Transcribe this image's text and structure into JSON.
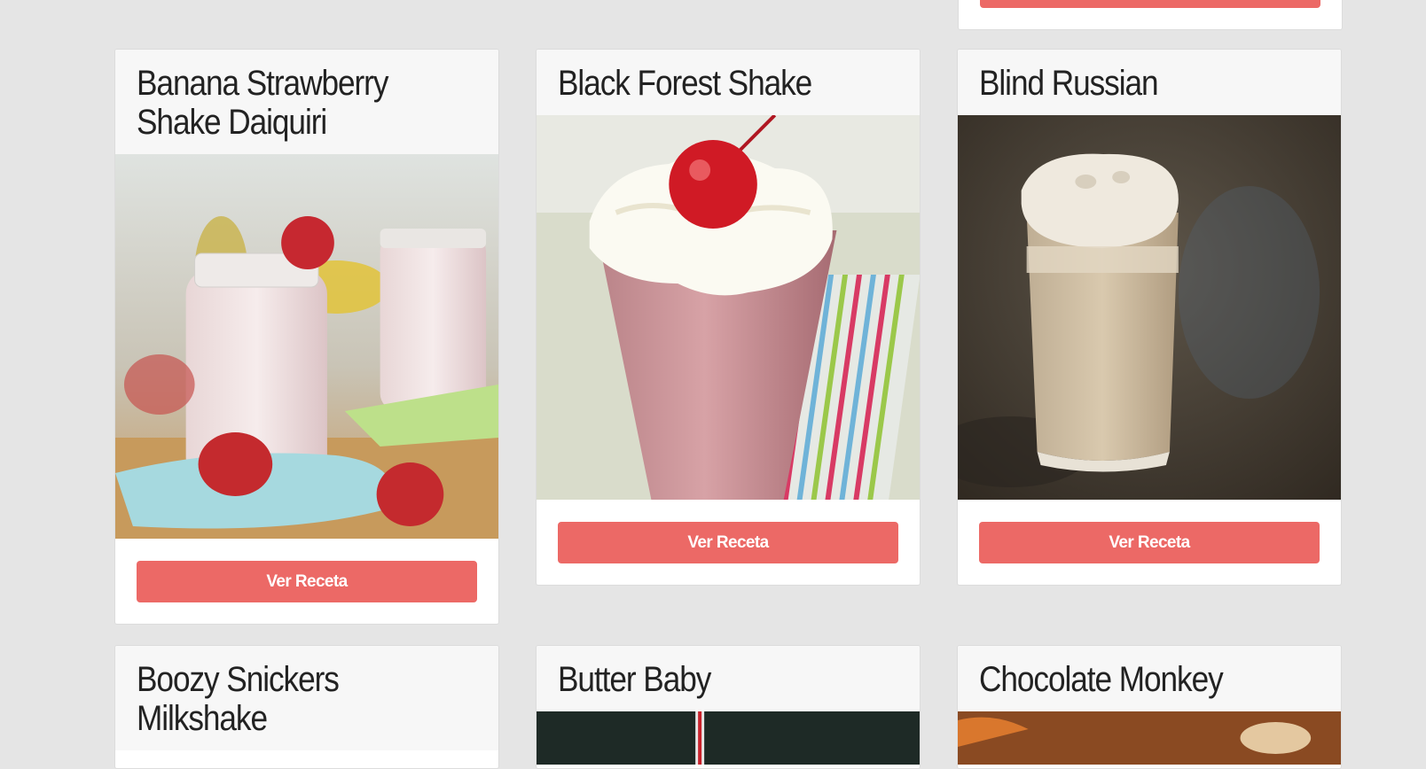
{
  "cards": [
    {
      "title_line1": "Banana Strawberry",
      "title_line2": "Shake Daiquiri",
      "button": "Ver Receta",
      "image": "strawberry-banana-shake-photo"
    },
    {
      "title_line1": "Black Forest Shake",
      "button": "Ver Receta",
      "image": "cherry-milkshake-photo"
    },
    {
      "title_line1": "Blind Russian",
      "button": "Ver Receta",
      "image": "coffee-cream-drink-photo"
    },
    {
      "title_line1": "Boozy Snickers",
      "title_line2": "Milkshake",
      "image": "snickers-milkshake-photo"
    },
    {
      "title_line1": "Butter Baby",
      "image": "butter-baby-photo"
    },
    {
      "title_line1": "Chocolate Monkey",
      "image": "chocolate-monkey-photo"
    }
  ],
  "colors": {
    "page_bg": "#e5e5e5",
    "button": "#ec6966",
    "header_bg": "#f7f7f7"
  }
}
